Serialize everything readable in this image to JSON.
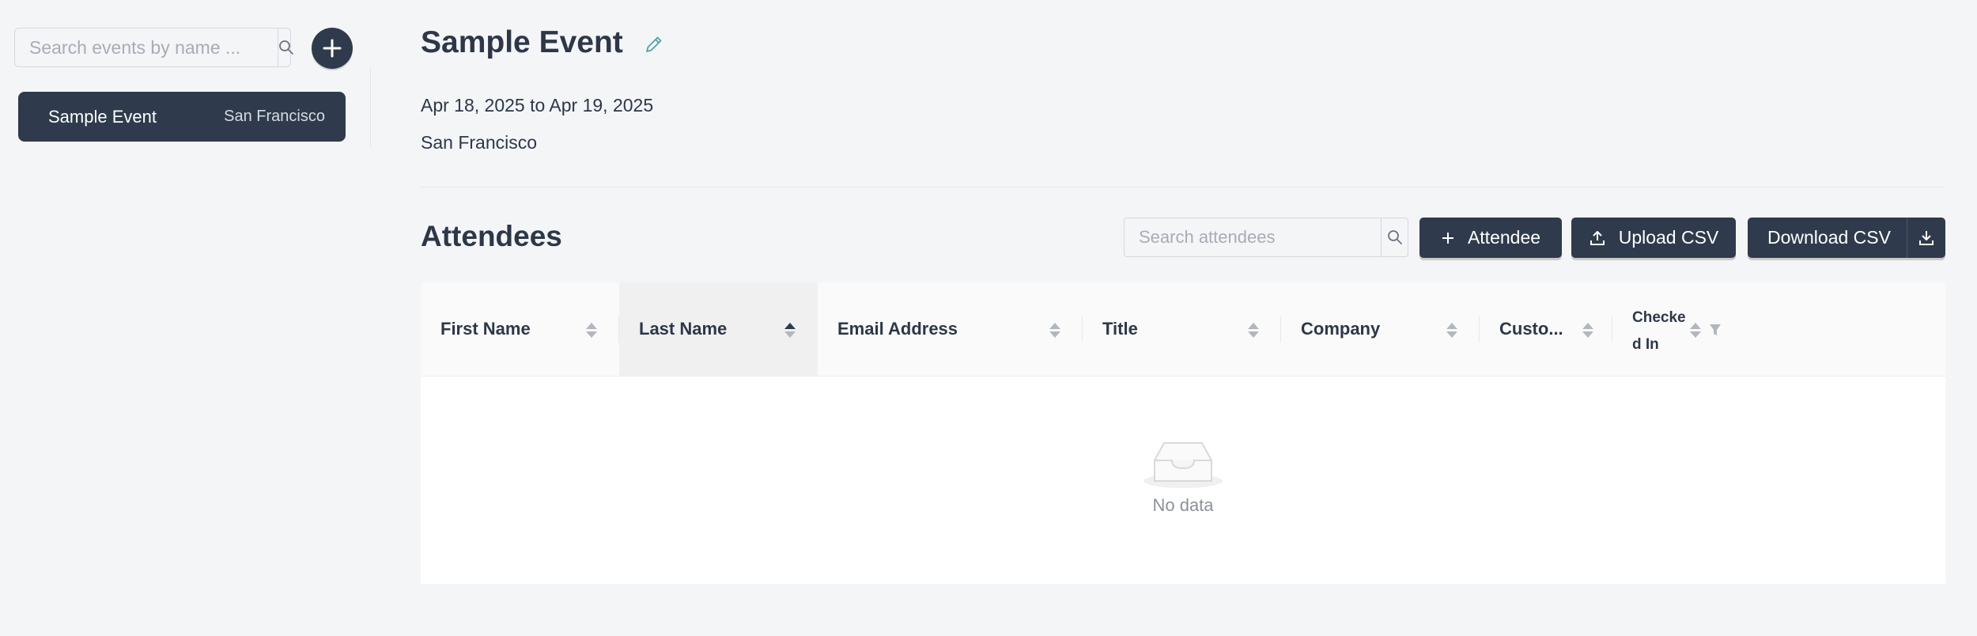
{
  "sidebar": {
    "search": {
      "placeholder": "Search events by name ...",
      "value": ""
    },
    "events": [
      {
        "name": "Sample Event",
        "location": "San Francisco",
        "selected": true
      }
    ]
  },
  "event": {
    "title": "Sample Event",
    "dates": "Apr 18, 2025 to Apr 19, 2025",
    "location": "San Francisco"
  },
  "attendees": {
    "section_title": "Attendees",
    "search": {
      "placeholder": "Search attendees",
      "value": ""
    },
    "buttons": {
      "add": "Attendee",
      "upload": "Upload CSV",
      "download": "Download CSV"
    },
    "columns": [
      {
        "label": "First Name",
        "sort": "none"
      },
      {
        "label": "Last Name",
        "sort": "ascending"
      },
      {
        "label": "Email Address",
        "sort": "none"
      },
      {
        "label": "Title",
        "sort": "none"
      },
      {
        "label": "Company",
        "sort": "none"
      },
      {
        "label": "Custo...",
        "sort": "none"
      },
      {
        "label": "Checked In",
        "label_line1": "Checke",
        "label_line2": "d In",
        "sort": "none",
        "filterable": true
      }
    ],
    "rows": [],
    "empty_text": "No data"
  },
  "colors": {
    "primary": "#2f3b4c",
    "background": "#f4f5f7",
    "accent_edit": "#4fa3a5"
  },
  "icons": {
    "search": "search-icon",
    "add": "plus-icon",
    "edit": "pencil-icon",
    "upload": "upload-icon",
    "download": "download-icon",
    "filter": "filter-icon",
    "empty": "empty-inbox-icon"
  }
}
